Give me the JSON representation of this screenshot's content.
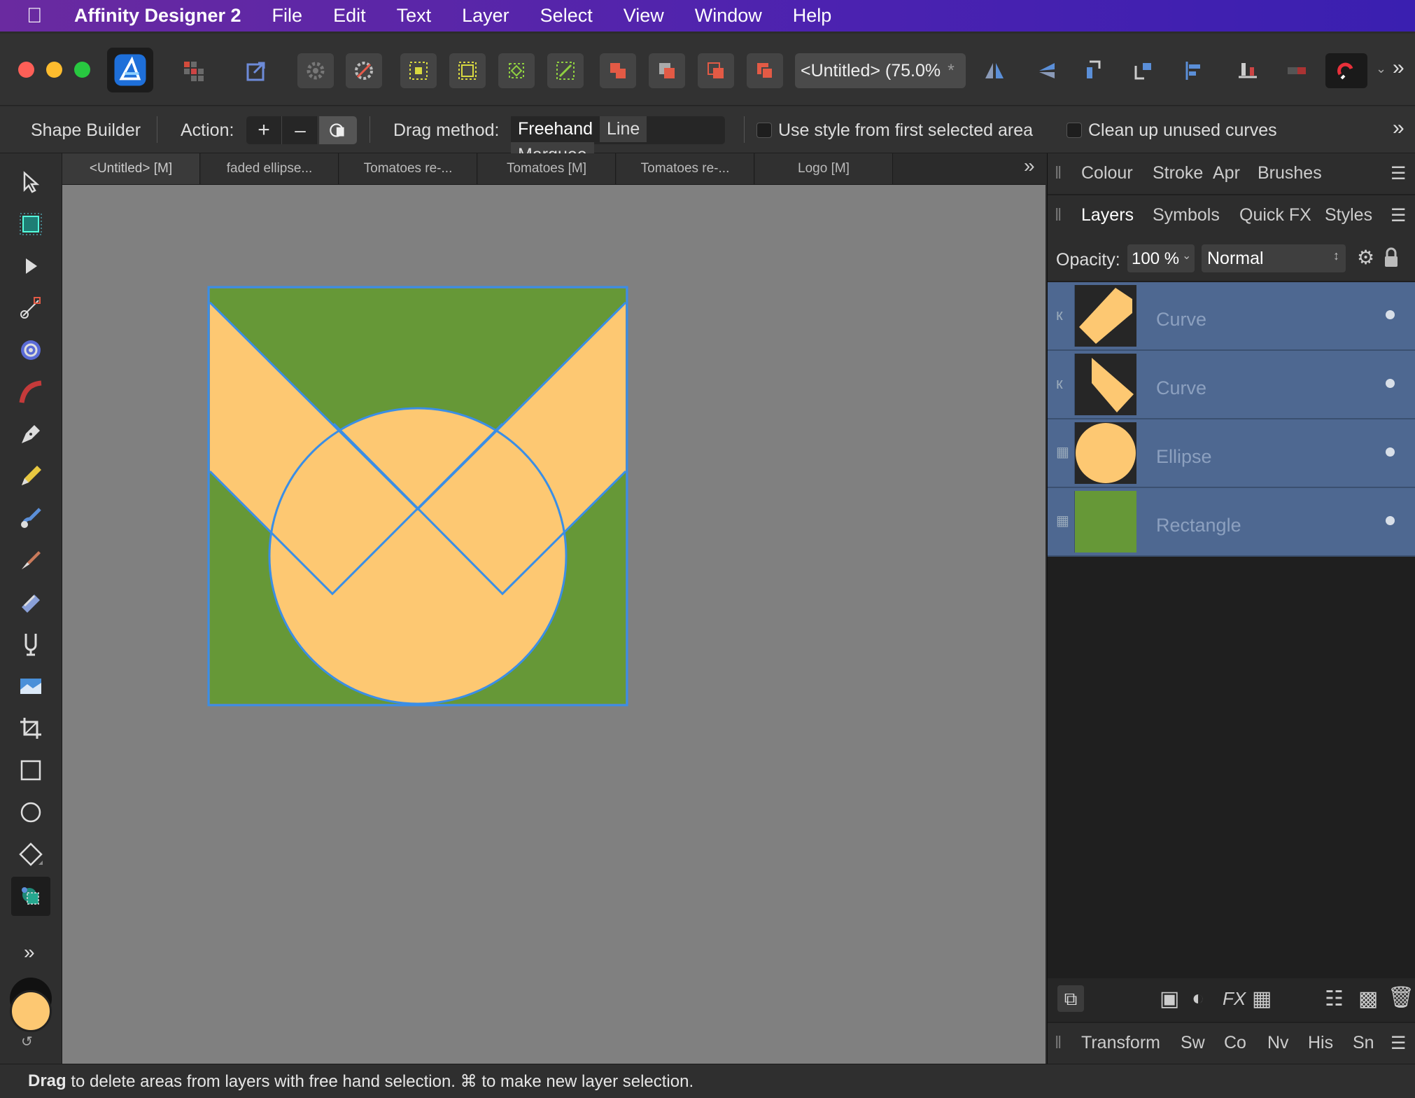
{
  "menubar": {
    "app_name": "Affinity Designer 2",
    "items": [
      "File",
      "Edit",
      "Text",
      "Layer",
      "Select",
      "View",
      "Window",
      "Help"
    ]
  },
  "toolbar": {
    "document_title": "<Untitled> (75.0%",
    "modified_mark": "*",
    "more_glyph": "»"
  },
  "context_toolbar": {
    "tool_name": "Shape Builder",
    "action_label": "Action:",
    "action_add": "+",
    "action_subtract": "–",
    "drag_method_label": "Drag method:",
    "drag_methods": [
      "Freehand",
      "Line",
      "Marquee"
    ],
    "selected_drag_method": "Freehand",
    "use_style_label": "Use style from first selected area",
    "use_style_checked": false,
    "cleanup_label": "Clean up unused curves",
    "cleanup_checked": false
  },
  "doc_tabs": [
    "<Untitled> [M]",
    "faded ellipse...",
    "Tomatoes re-...",
    "Tomatoes [M]",
    "Tomatoes re-...",
    "Logo [M]"
  ],
  "top_panel_tabs": [
    "Colour",
    "Stroke",
    "Apr",
    "Brushes"
  ],
  "layers_panel": {
    "tabs": [
      "Layers",
      "Symbols",
      "Quick FX",
      "Styles"
    ],
    "active_tab": "Layers",
    "opacity_label": "Opacity:",
    "opacity_value": "100 %",
    "blend_mode": "Normal",
    "layers": [
      {
        "name": "Curve",
        "kind": "curve-a",
        "visible": true
      },
      {
        "name": "Curve",
        "kind": "curve-b",
        "visible": true
      },
      {
        "name": "Ellipse",
        "kind": "ellipse",
        "visible": true
      },
      {
        "name": "Rectangle",
        "kind": "rectangle",
        "visible": true
      }
    ]
  },
  "bottom_panel_tabs": [
    "Transform",
    "Sw",
    "Co",
    "Nv",
    "His",
    "Sn"
  ],
  "status": {
    "bold": "Drag",
    "text": " to delete areas from layers with free hand selection. ⌘ to make new layer selection."
  },
  "colors": {
    "green": "#669837",
    "orange": "#fdc872",
    "selection_blue": "#3a8ee6",
    "canvas_grey": "#808080",
    "layer_selected": "#4e6891"
  }
}
